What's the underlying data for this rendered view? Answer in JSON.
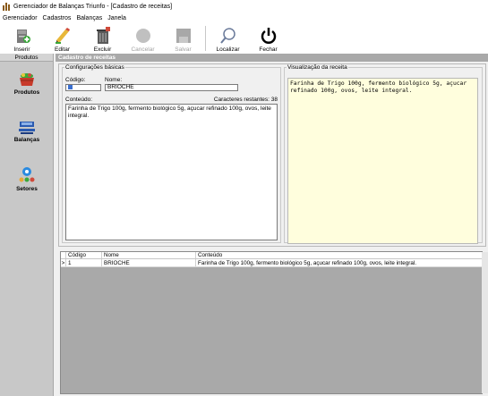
{
  "window": {
    "title": "Gerenciador de Balanças Triunfo - [Cadastro de receitas]"
  },
  "menu": {
    "items": [
      "Gerenciador",
      "Cadastros",
      "Balanças",
      "Janela"
    ]
  },
  "toolbar": {
    "insert_label": "Inserir",
    "edit_label": "Editar",
    "delete_label": "Excluir",
    "cancel_label": "Cancelar",
    "save_label": "Salvar",
    "find_label": "Localizar",
    "close_label": "Fechar"
  },
  "sidebar": {
    "header": "Produtos",
    "items": [
      {
        "label": "Produtos",
        "icon": "basket-icon"
      },
      {
        "label": "Balanças",
        "icon": "scale-icon"
      },
      {
        "label": "Setores",
        "icon": "sectors-icon"
      }
    ]
  },
  "main": {
    "header": "Cadastro de receitas",
    "basic_group_label": "Configurações básicas",
    "code_label": "Código:",
    "name_label": "Nome:",
    "name_value": "BRIOCHE",
    "content_label": "Conteúdo:",
    "remaining_label": "Caracteres restantes: 38",
    "content_value": "Farinha de Trigo 100g, fermento biológico 5g, açucar refinado 100g, ovos, leite integral.",
    "preview_label": "Visualização da receita",
    "preview_line1": "Farinha de Trigo 100g, fermento biológico 5g, açucar",
    "preview_line2": "refinado 100g, ovos, leite integral."
  },
  "grid": {
    "columns": [
      "Código",
      "Nome",
      "Conteúdo"
    ],
    "rows": [
      {
        "indicator": ">",
        "code": "1",
        "name": "BRIOCHE",
        "content": "Farinha de Trigo 100g, fermento biológico 5g, açucar refinado 100g, ovos, leite integral."
      }
    ]
  }
}
